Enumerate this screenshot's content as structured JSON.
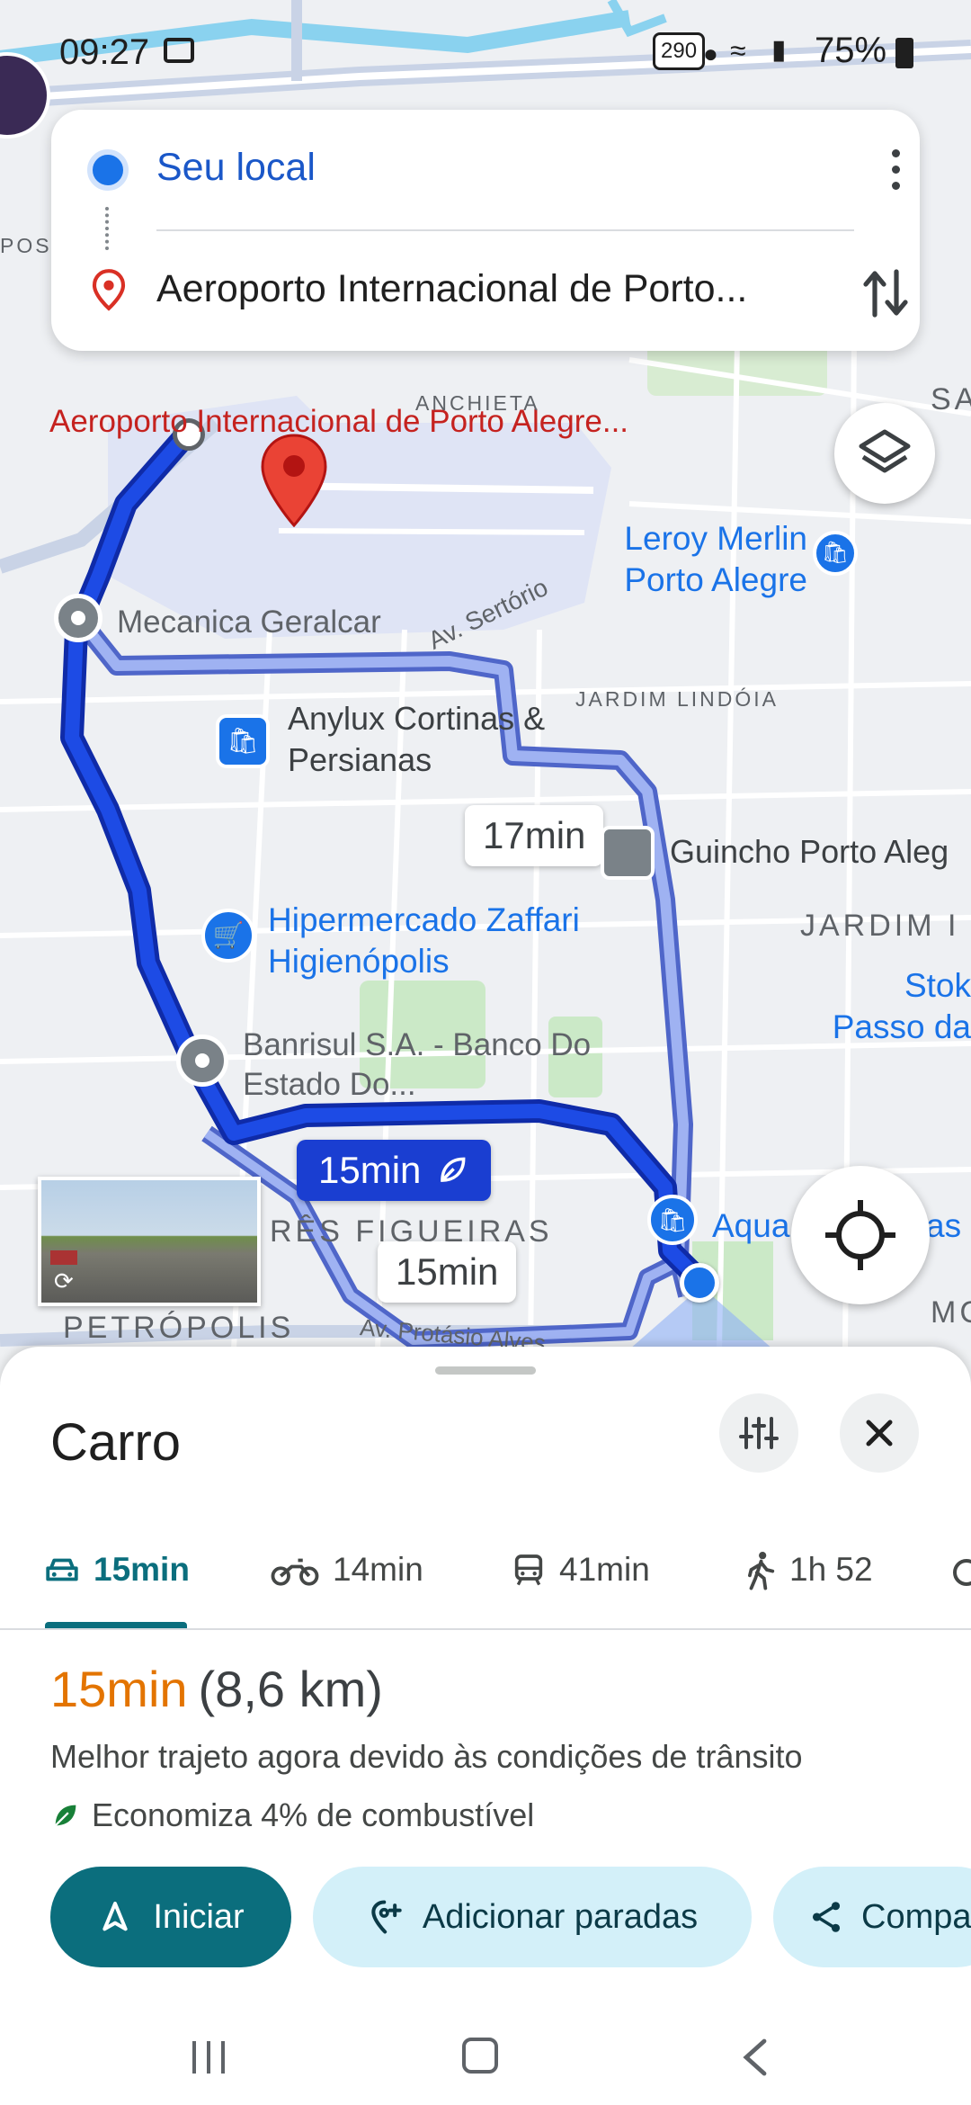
{
  "status": {
    "time": "09:27",
    "speed_badge": "290",
    "battery": "75%"
  },
  "search": {
    "origin": "Seu local",
    "destination": "Aeroporto Internacional de Porto..."
  },
  "map": {
    "labels": {
      "airport": "Aeroporto Internacional de Porto Alegre...",
      "anchieta": "ANCHIETA",
      "sa": "SA",
      "pos": "POS",
      "leroy": "Leroy Merlin Porto Alegre",
      "mecanica": "Mecanica Geralcar",
      "av_sertorio": "Av. Sertório",
      "jardim_lindoia": "JARDIM LINDÓIA",
      "anylux": "Anylux Cortinas & Persianas",
      "guincho": "Guincho Porto Aleg",
      "jardim": "JARDIM I",
      "hipermercado": "Hipermercado Zaffari Higienópolis",
      "stok": "Stok Passo da",
      "banrisul": "Banrisul S.A. - Banco Do Estado Do...",
      "tres_figueiras": "RÊS FIGUEIRAS",
      "aqua": "Aqua",
      "aqua_end": "as",
      "mo": "MC",
      "petropolis": "PETRÓPOLIS",
      "av_protasio": "Av. Protásio Alves"
    },
    "durations": {
      "alt_top": "17min",
      "main": "15min",
      "alt_bottom": "15min"
    }
  },
  "sheet": {
    "title": "Carro",
    "modes": [
      {
        "label": "15min",
        "icon": "car-icon"
      },
      {
        "label": "14min",
        "icon": "motorcycle-icon"
      },
      {
        "label": "41min",
        "icon": "transit-icon"
      },
      {
        "label": "1h 52",
        "icon": "walk-icon"
      }
    ],
    "route_time": "15min",
    "route_distance": "(8,6 km)",
    "route_desc": "Melhor trajeto agora devido às condições de trânsito",
    "eco": "Economiza 4% de combustível",
    "buttons": {
      "start": "Iniciar",
      "add_stops": "Adicionar paradas",
      "share": "Compa"
    }
  },
  "colors": {
    "accent": "#1a73e8",
    "route": "#1a3ed1",
    "teal": "#0b6e7d",
    "orange": "#e37400"
  }
}
